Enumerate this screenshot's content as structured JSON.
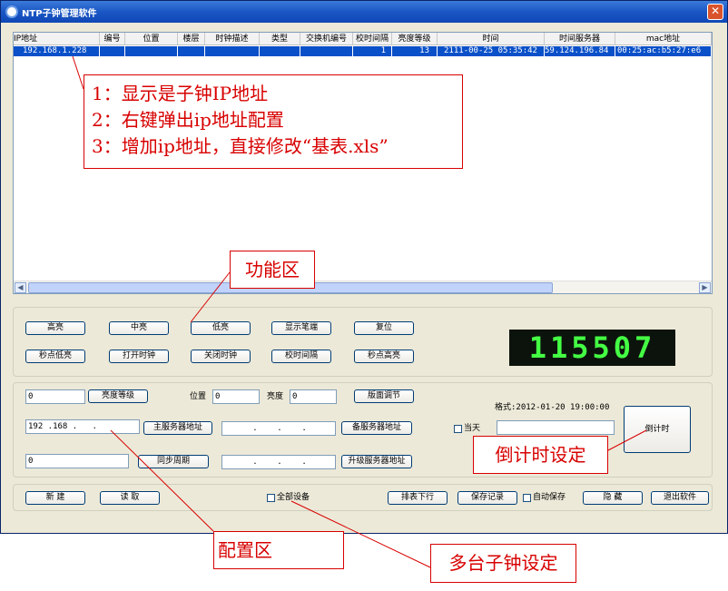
{
  "window": {
    "title": "NTP子钟管理软件",
    "close_label": "✕"
  },
  "table": {
    "columns": [
      "IP地址",
      "编号",
      "位置",
      "楼层",
      "时钟描述",
      "类型",
      "交换机编号",
      "校时间隔",
      "亮度等级",
      "时间",
      "时间服务器",
      "mac地址"
    ],
    "rows": [
      [
        "192.168.1.228",
        "",
        "",
        "",
        "",
        "",
        "",
        "1",
        "13",
        "2111-00-25 05:35:42",
        "59.124.196.84",
        "00:25:ac:b5:27:e6"
      ]
    ]
  },
  "function_buttons": [
    "高亮",
    "中亮",
    "低亮",
    "显示笔端",
    "复位",
    "秒点低亮",
    "打开时钟",
    "关闭时钟",
    "校时间隔",
    "秒点高亮"
  ],
  "clock_display": "115507",
  "config": {
    "input1": "0",
    "brightness_level_btn": "亮度等级",
    "position_label": "位置",
    "position_value": "0",
    "brightness_label": "亮度",
    "brightness_value": "0",
    "screen_adjust_btn": "版面调节",
    "format_label": "格式:2012-01-20 19:00:00",
    "main_ip": "192 .168 .   .",
    "main_server_btn": "主服务器地址",
    "backup_ip": ".    .    .",
    "backup_server_btn": "备服务器地址",
    "today_label": "当天",
    "countdown_btn": "倒计时",
    "input3": "0",
    "sync_btn": "同步周期",
    "upgrade_ip": ".    .    .",
    "upgrade_server_btn": "升级服务器地址"
  },
  "bottom": {
    "new_btn": "新 建",
    "read_btn": "读 取",
    "all_devices_label": "全部设备",
    "sort_btn": "排表下行",
    "save_record_btn": "保存记录",
    "auto_save_label": "自动保存",
    "hide_btn": "隐 藏",
    "exit_btn": "退出软件"
  },
  "annotations": {
    "note_lines": [
      "1：显示是子钟IP地址",
      "2：右键弹出ip地址配置",
      "3：增加ip地址，直接修改“基表.xls”"
    ],
    "function_area": "功能区",
    "countdown_setting": "倒计时设定",
    "config_area": "配置区",
    "multi_clock": "多台子钟设定"
  }
}
